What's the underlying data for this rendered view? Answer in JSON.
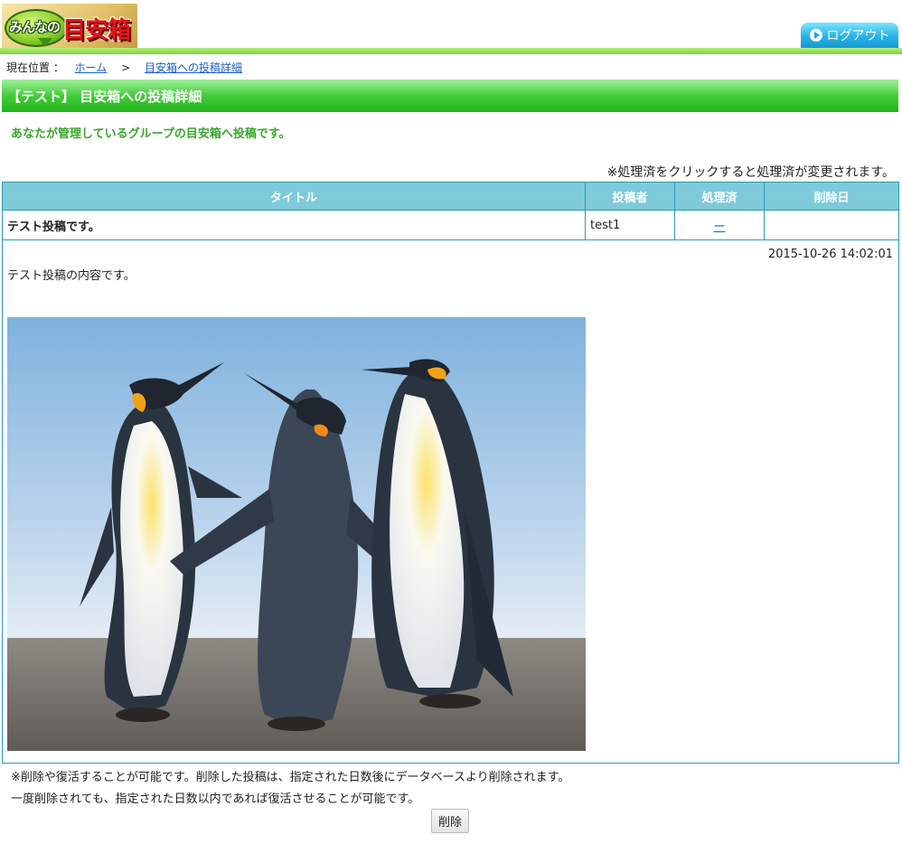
{
  "header": {
    "logo_small": "みんなの",
    "logo_big": "目安箱",
    "logout_label": "ログアウト"
  },
  "breadcrumb": {
    "label": "現在位置 ：",
    "home": "ホーム",
    "separator": ">",
    "current": "目安箱への投稿詳細"
  },
  "page_title": "【テスト】 目安箱への投稿詳細",
  "intro": "あなたが管理しているグループの目安箱へ投稿です。",
  "click_note": "※処理済をクリックすると処理済が変更されます。",
  "table": {
    "headers": [
      "タイトル",
      "投稿者",
      "処理済",
      "削除日"
    ],
    "row": {
      "title": "テスト投稿です。",
      "author": "test1",
      "processed": "ー",
      "deleted_date": ""
    },
    "post": {
      "timestamp": "2015-10-26 14:02:01",
      "body": "テスト投稿の内容です。"
    }
  },
  "notes": [
    "※削除や復活することが可能です。削除した投稿は、指定された日数後にデータベースより削除されます。",
    "一度削除されても、指定された日数以内であれば復活させることが可能です。"
  ],
  "delete_label": "削除",
  "colors": {
    "header_green": "#44cc3b",
    "table_header": "#7ecada",
    "table_border": "#2a9ab6",
    "intro_green": "#3aa52c",
    "logout_blue": "#27b4ea"
  }
}
